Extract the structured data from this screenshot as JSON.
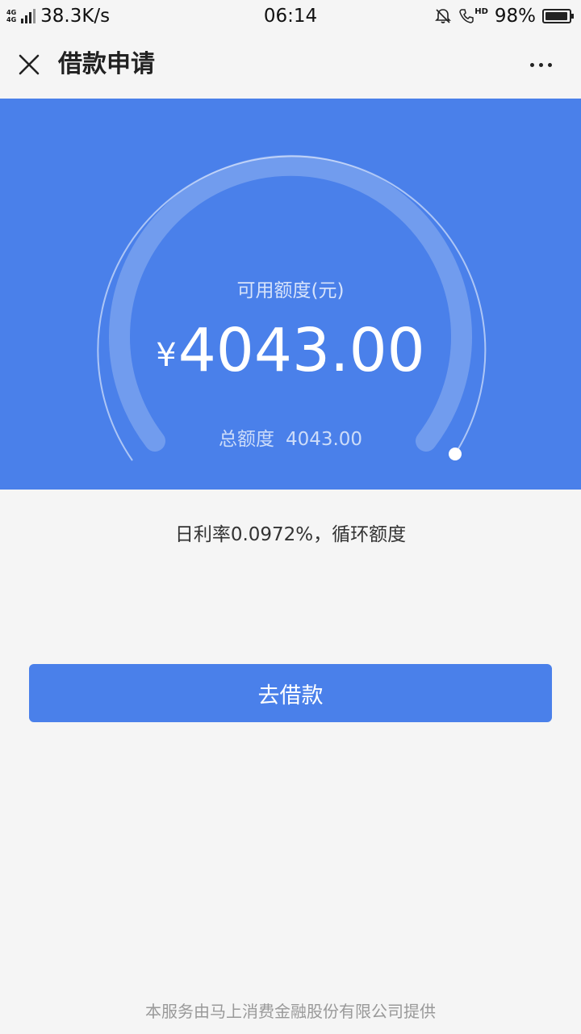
{
  "status_bar": {
    "network_tags": [
      "4G",
      "4G"
    ],
    "speed": "38.3K/s",
    "time": "06:14",
    "hd_tag": "HD",
    "battery": "98%",
    "battery_level": 0.98
  },
  "nav": {
    "title": "借款申请"
  },
  "credit": {
    "available_label": "可用额度(元)",
    "currency_symbol": "¥",
    "available_amount": "4043.00",
    "total_label": "总额度",
    "total_amount": "4043.00"
  },
  "rate_text": "日利率0.0972%，循环额度",
  "borrow_button_label": "去借款",
  "footer_text": "本服务由马上消费金融股份有限公司提供",
  "colors": {
    "primary": "#4a80ea",
    "background": "#f5f5f5",
    "text_primary": "#333333",
    "text_muted": "#999999"
  }
}
